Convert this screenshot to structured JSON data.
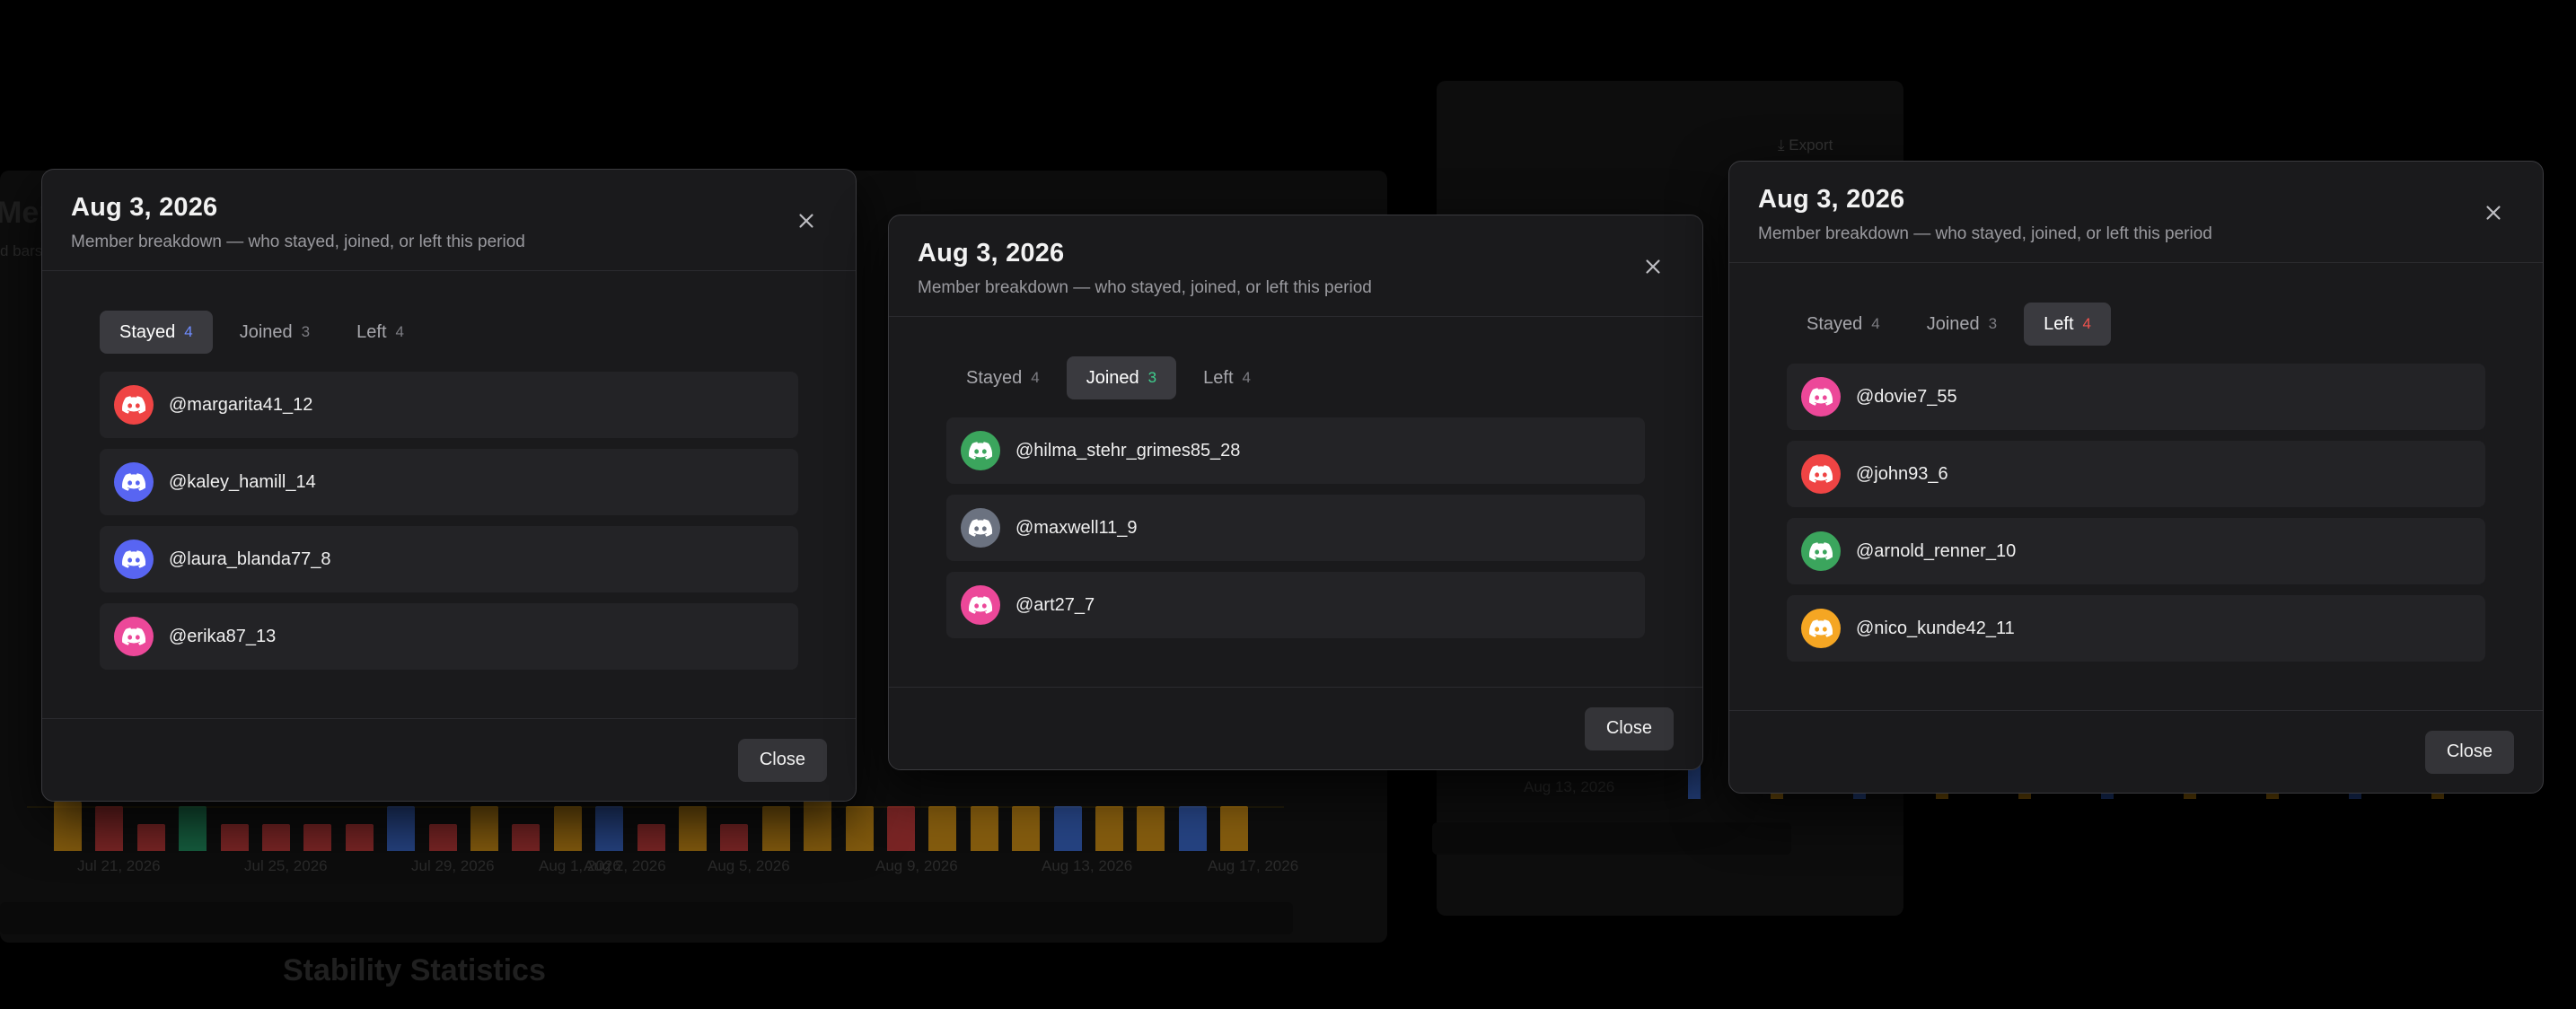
{
  "background": {
    "heading_left": "Membe",
    "subtext_left": "d bars",
    "export_label": "Export",
    "section_title": "Stability Statistics",
    "date_ticks": [
      "Jul 21, 2026",
      "Jul 25, 2026",
      "Jul 29, 2026",
      "Aug 1, 2026",
      "Aug 2, 2026",
      "Aug 5, 2026",
      "Aug 9, 2026",
      "Aug 13, 2026",
      "Aug 17, 2026"
    ],
    "date_tick_right": "Aug 13, 2026"
  },
  "colors": {
    "stayed": "#6f8cff",
    "joined": "#3fcf8e",
    "left": "#f0534e",
    "bar_orange": "#e59c10",
    "bar_red": "#d63b3b",
    "bar_blue": "#3a6fe0",
    "bar_green": "#1fa36a"
  },
  "modals": [
    {
      "title": "Aug 3, 2026",
      "subtitle": "Member breakdown — who stayed, joined, or left this period",
      "active_tab": "Stayed",
      "tabs": [
        {
          "label": "Stayed",
          "count": "4"
        },
        {
          "label": "Joined",
          "count": "3"
        },
        {
          "label": "Left",
          "count": "4"
        }
      ],
      "members": [
        {
          "name": "@margarita41_12",
          "avatar_color": "#ef4444",
          "icon": "discord-icon"
        },
        {
          "name": "@kaley_hamill_14",
          "avatar_color": "#5865f2",
          "icon": "discord-icon"
        },
        {
          "name": "@laura_blanda77_8",
          "avatar_color": "#5865f2",
          "icon": "discord-icon"
        },
        {
          "name": "@erika87_13",
          "avatar_color": "#ec4899",
          "icon": "discord-icon"
        }
      ],
      "close_label": "Close"
    },
    {
      "title": "Aug 3, 2026",
      "subtitle": "Member breakdown — who stayed, joined, or left this period",
      "active_tab": "Joined",
      "tabs": [
        {
          "label": "Stayed",
          "count": "4"
        },
        {
          "label": "Joined",
          "count": "3"
        },
        {
          "label": "Left",
          "count": "4"
        }
      ],
      "members": [
        {
          "name": "@hilma_stehr_grimes85_28",
          "avatar_color": "#3ba55d",
          "icon": "discord-icon"
        },
        {
          "name": "@maxwell11_9",
          "avatar_color": "#6b7280",
          "icon": "discord-icon"
        },
        {
          "name": "@art27_7",
          "avatar_color": "#ec4899",
          "icon": "discord-icon"
        }
      ],
      "close_label": "Close"
    },
    {
      "title": "Aug 3, 2026",
      "subtitle": "Member breakdown — who stayed, joined, or left this period",
      "active_tab": "Left",
      "tabs": [
        {
          "label": "Stayed",
          "count": "4"
        },
        {
          "label": "Joined",
          "count": "3"
        },
        {
          "label": "Left",
          "count": "4"
        }
      ],
      "members": [
        {
          "name": "@dovie7_55",
          "avatar_color": "#ec4899",
          "icon": "discord-icon"
        },
        {
          "name": "@john93_6",
          "avatar_color": "#ef4444",
          "icon": "discord-icon"
        },
        {
          "name": "@arnold_renner_10",
          "avatar_color": "#3ba55d",
          "icon": "discord-icon"
        },
        {
          "name": "@nico_kunde42_11",
          "avatar_color": "#f5a623",
          "icon": "discord-icon"
        }
      ],
      "close_label": "Close"
    }
  ]
}
